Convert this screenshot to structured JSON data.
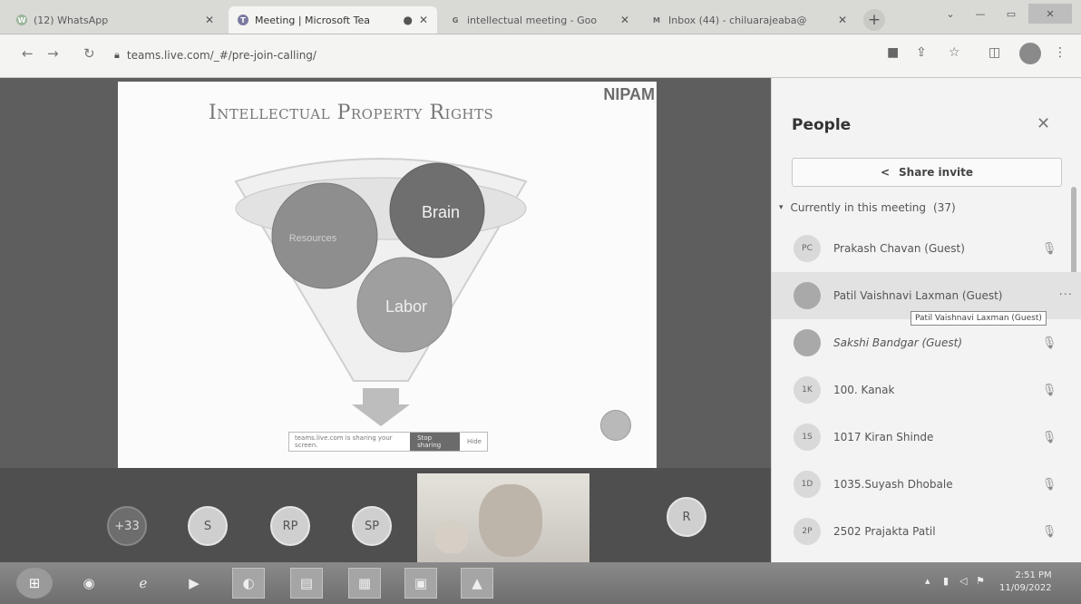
{
  "browser": {
    "tabs": [
      {
        "title": "(12) WhatsApp",
        "favicon": "W",
        "active": false
      },
      {
        "title": "Meeting | Microsoft Tea",
        "favicon": "T",
        "active": true
      },
      {
        "title": "intellectual meeting - Goo",
        "favicon": "G",
        "active": false
      },
      {
        "title": "Inbox (44) - chiluarajeaba@",
        "favicon": "M",
        "active": false
      }
    ],
    "new_tab_symbol": "+",
    "url": "teams.live.com/_#/pre-join-calling/"
  },
  "slide": {
    "title": "Intellectual Property Rights",
    "logo": "NIPAM",
    "circles": {
      "brain": "Brain",
      "resources": "Resources",
      "labor": "Labor"
    },
    "mini_bar_text": "teams.live.com is sharing your screen.",
    "mini_bar_button": "Stop sharing",
    "mini_bar_hide": "Hide"
  },
  "stage": {
    "avatars": [
      "+33",
      "S",
      "RP",
      "SP",
      "R"
    ]
  },
  "people_panel": {
    "title": "People",
    "share_label": "Share invite",
    "section_label": "Currently in this meeting",
    "count": "(37)",
    "participants": [
      {
        "initials": "PC",
        "name": "Prakash Chavan (Guest)",
        "italic": false
      },
      {
        "initials": "",
        "name": "Patil Vaishnavi Laxman (Guest)",
        "italic": false,
        "hover": true
      },
      {
        "initials": "",
        "name": "Sakshi Bandgar (Guest)",
        "italic": true
      },
      {
        "initials": "1K",
        "name": "100. Kanak",
        "italic": false
      },
      {
        "initials": "1S",
        "name": "1017 Kiran Shinde",
        "italic": false
      },
      {
        "initials": "1D",
        "name": "1035.Suyash Dhobale",
        "italic": false
      },
      {
        "initials": "2P",
        "name": "2502 Prajakta Patil",
        "italic": false
      }
    ],
    "tooltip": "Patil Vaishnavi Laxman (Guest)",
    "more_symbol": "···"
  },
  "taskbar": {
    "time": "2:51 PM",
    "date": "11/09/2022"
  }
}
